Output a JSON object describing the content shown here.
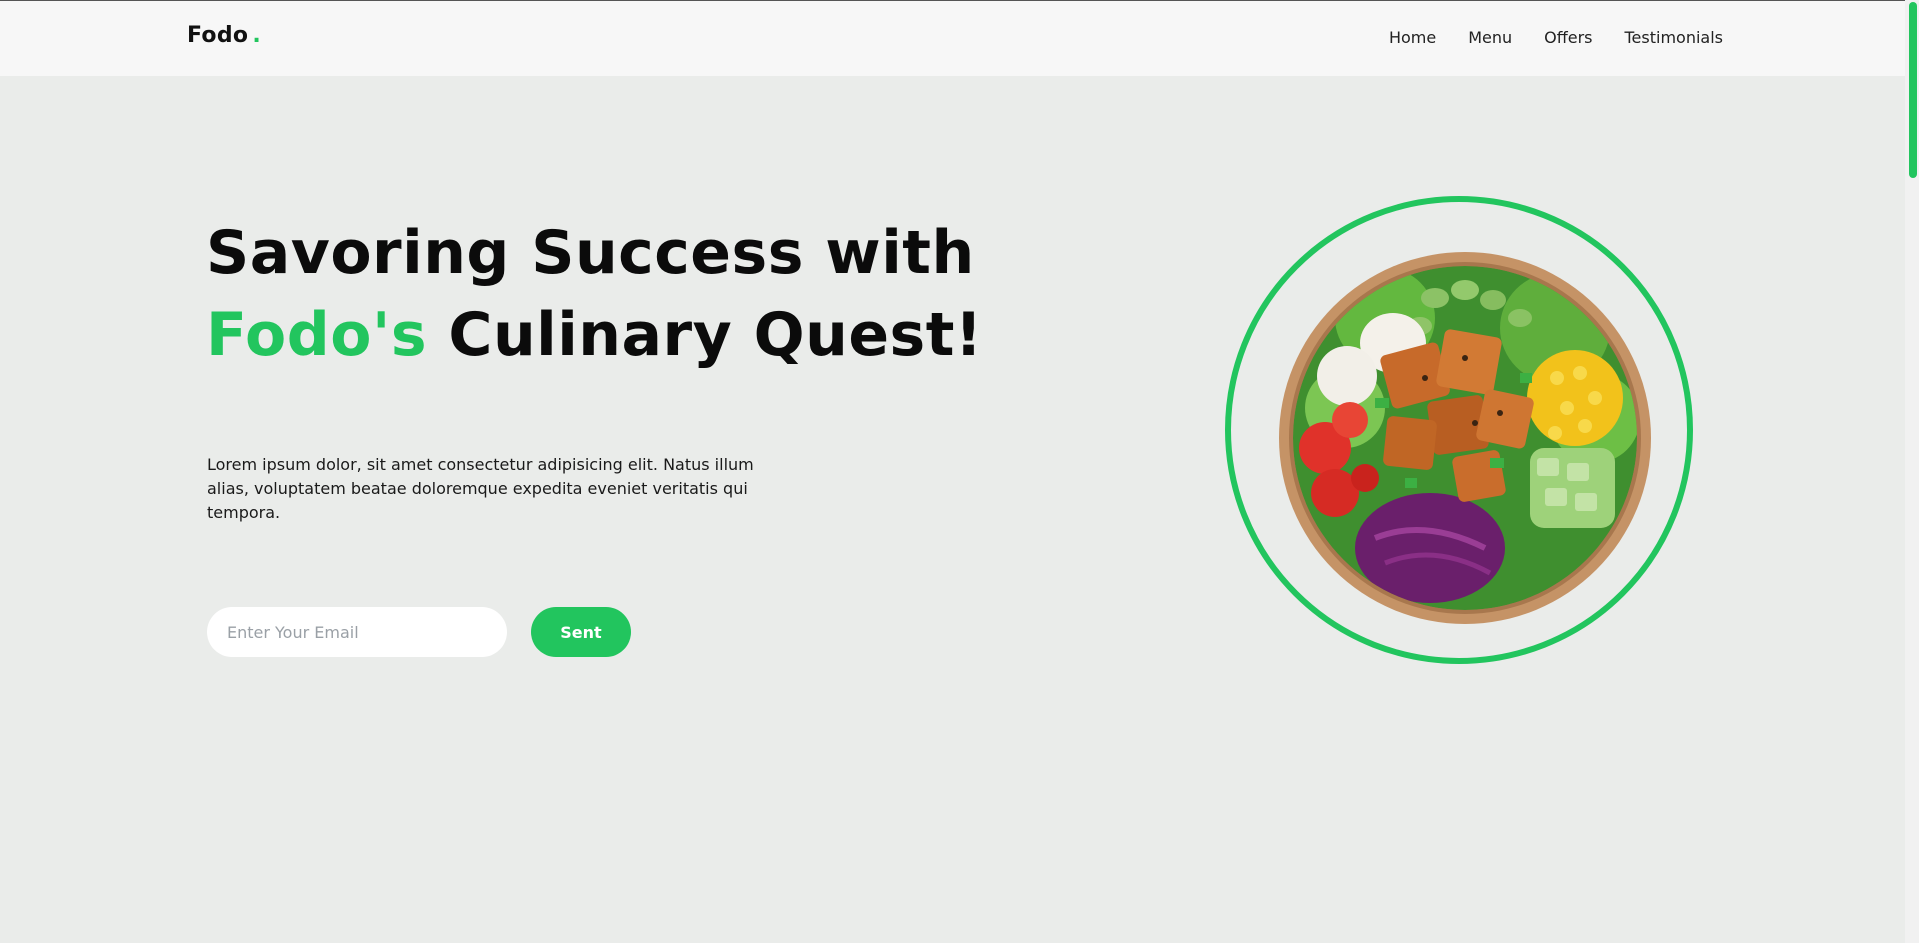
{
  "brand": {
    "name": "Fodo",
    "dot": "."
  },
  "nav": {
    "items": [
      "Home",
      "Menu",
      "Offers",
      "Testimonials"
    ]
  },
  "hero": {
    "title_line1": "Savoring Success with",
    "title_accent": "Fodo's",
    "title_line2_rest": "Culinary Quest!",
    "description": "Lorem ipsum dolor, sit amet consectetur adipisicing elit. Natus illum alias, voluptatem beatae doloremque expedita eveniet veritatis qui tempora.",
    "email_placeholder": "Enter Your Email",
    "button_label": "Sent"
  },
  "colors": {
    "accent": "#22c55e",
    "background": "#eaecea",
    "navbar": "#f7f7f7"
  }
}
